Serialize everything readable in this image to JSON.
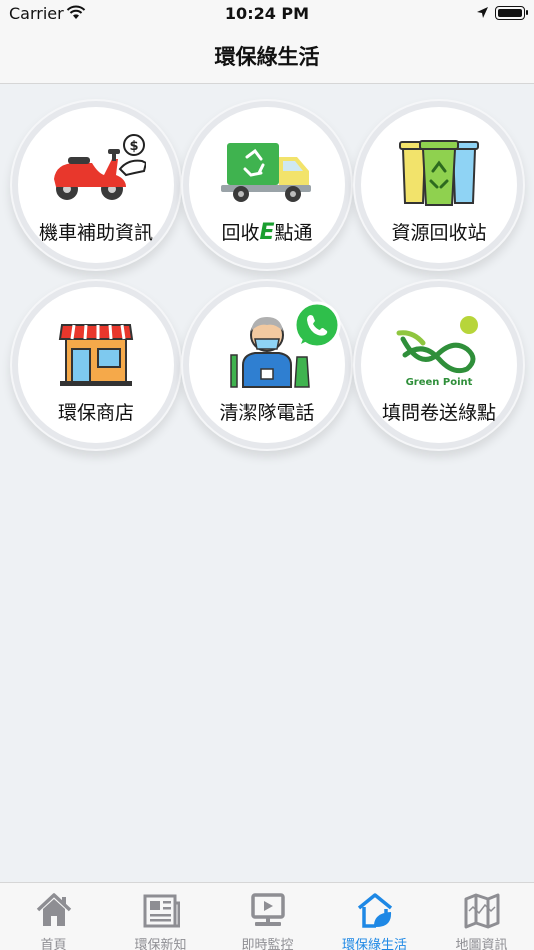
{
  "status_bar": {
    "carrier": "Carrier",
    "time": "10:24 PM"
  },
  "nav": {
    "title": "環保綠生活"
  },
  "tiles": [
    {
      "label": "機車補助資訊",
      "icon": "scooter-subsidy-icon"
    },
    {
      "label_prefix": "回收",
      "label_highlight": "E",
      "label_suffix": "點通",
      "icon": "recycle-truck-icon"
    },
    {
      "label": "資源回收站",
      "icon": "recycle-bins-icon"
    },
    {
      "label": "環保商店",
      "icon": "store-icon"
    },
    {
      "label": "清潔隊電話",
      "icon": "cleaner-worker-icon",
      "badge": "whatsapp-phone-icon"
    },
    {
      "label": "填問卷送綠點",
      "icon": "green-point-logo",
      "logo_text": "Green Point"
    }
  ],
  "tab_bar": {
    "active_index": 3,
    "active_color": "#1e88e5",
    "inactive_color": "#8e8e93",
    "items": [
      {
        "label": "首頁",
        "icon": "home-icon"
      },
      {
        "label": "環保新知",
        "icon": "newspaper-icon"
      },
      {
        "label": "即時監控",
        "icon": "monitor-icon"
      },
      {
        "label": "環保綠生活",
        "icon": "leaf-house-icon"
      },
      {
        "label": "地圖資訊",
        "icon": "map-icon"
      }
    ]
  }
}
